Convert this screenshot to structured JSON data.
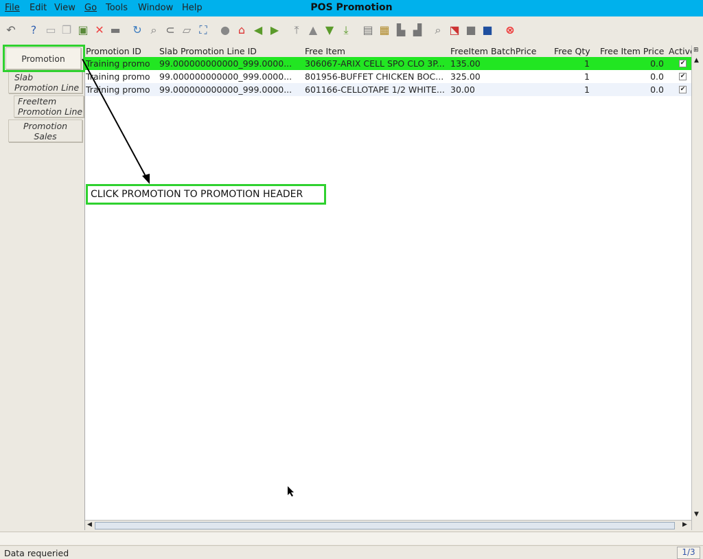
{
  "window": {
    "title": "POS Promotion"
  },
  "menu": [
    "File",
    "Edit",
    "View",
    "Go",
    "Tools",
    "Window",
    "Help"
  ],
  "toolbar_icons": [
    "undo-icon",
    "help-icon",
    "new-icon",
    "copy-icon",
    "save-icon",
    "delete-icon",
    "save-alt-icon",
    "refresh-icon",
    "find-icon",
    "attachment-icon",
    "chat-icon",
    "zoom-icon",
    "history-icon",
    "home-icon",
    "back-icon",
    "forward-icon",
    "first-record-icon",
    "previous-record-icon",
    "next-record-icon",
    "last-record-icon",
    "report-icon",
    "archive-icon",
    "print-preview-icon",
    "print-icon",
    "zoom-across-icon",
    "workflow-icon",
    "request-icon",
    "product-info-icon",
    "close-window-icon"
  ],
  "tabs": [
    {
      "label": "Promotion"
    },
    {
      "label1": "Slab",
      "label2": "Promotion Line"
    },
    {
      "label1": "FreeItem",
      "label2": "Promotion Line"
    },
    {
      "label1": "Promotion",
      "label2": "Sales"
    }
  ],
  "grid": {
    "columns": [
      "Promotion ID",
      "Slab Promotion Line ID",
      "Free Item",
      "FreeItem BatchPrice",
      "Free Qty",
      "Free Item Price",
      "Active"
    ],
    "rows": [
      {
        "promotion_id": "Training promo",
        "slab_line": "99.000000000000_999.0000...",
        "free_item": "306067-ARIX CELL SPO CLO 3P...",
        "batch_price": "135.00",
        "qty": "1",
        "price": "0.0",
        "active": "✔"
      },
      {
        "promotion_id": "Training promo",
        "slab_line": "99.000000000000_999.0000...",
        "free_item": "801956-BUFFET CHICKEN BOC...",
        "batch_price": "325.00",
        "qty": "1",
        "price": "0.0",
        "active": "✔"
      },
      {
        "promotion_id": "Training promo",
        "slab_line": "99.000000000000_999.0000...",
        "free_item": "601166-CELLOTAPE 1/2 WHITE...",
        "batch_price": "30.00",
        "qty": "1",
        "price": "0.0",
        "active": "✔"
      }
    ]
  },
  "annotation": {
    "text": "CLICK PROMOTION TO PROMOTION HEADER"
  },
  "status": {
    "message": "Data requeried",
    "page": "1/3"
  },
  "colors": {
    "menubar": "#00b1ec",
    "selected_row": "#22e622",
    "annotation": "#2fd12f"
  }
}
